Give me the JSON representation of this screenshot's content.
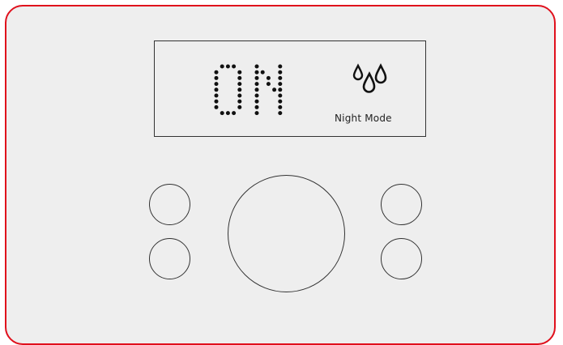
{
  "display": {
    "status_text": "ON",
    "mode_label": "Night Mode",
    "mode_icon": "water-drops-icon"
  },
  "controls": {
    "left_top": "round-button",
    "left_bottom": "round-button",
    "center": "dial-button",
    "right_top": "round-button",
    "right_bottom": "round-button"
  },
  "colors": {
    "frame_border": "#e0101c",
    "panel_background": "#eeeeee",
    "segment_dots": "#111111"
  }
}
